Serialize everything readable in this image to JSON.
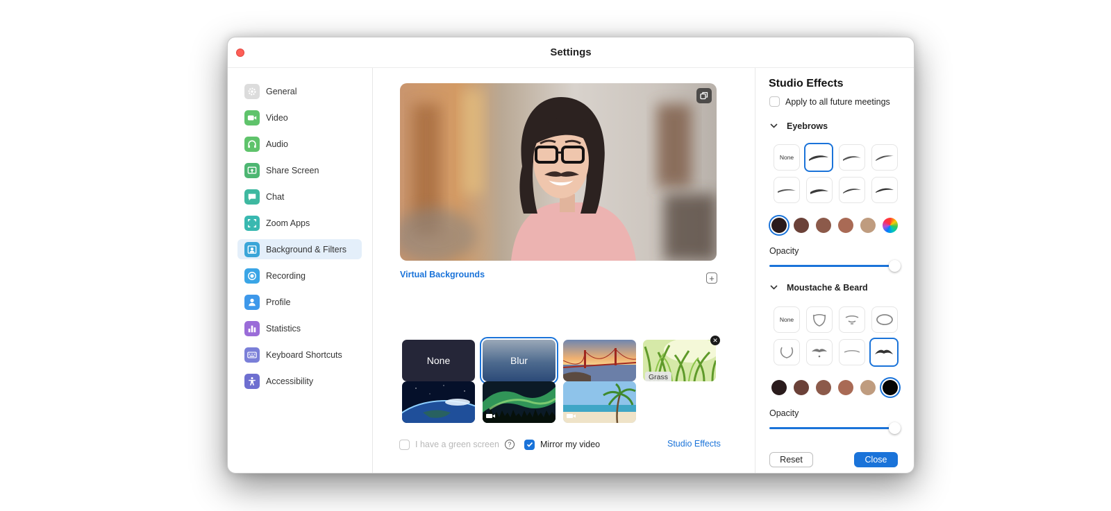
{
  "window": {
    "title": "Settings"
  },
  "sidebar": {
    "items": [
      {
        "label": "General",
        "icon": "gear-icon",
        "color": "#d9d9d9"
      },
      {
        "label": "Video",
        "icon": "video-camera-icon",
        "color": "#5fc36b"
      },
      {
        "label": "Audio",
        "icon": "headphones-icon",
        "color": "#5fc36b"
      },
      {
        "label": "Share Screen",
        "icon": "share-screen-icon",
        "color": "#4db672"
      },
      {
        "label": "Chat",
        "icon": "chat-bubble-icon",
        "color": "#3eb8a0"
      },
      {
        "label": "Zoom Apps",
        "icon": "zoom-apps-icon",
        "color": "#39b8b0"
      },
      {
        "label": "Background & Filters",
        "icon": "portrait-icon",
        "color": "#3aa5d8"
      },
      {
        "label": "Recording",
        "icon": "record-icon",
        "color": "#3aa5e6"
      },
      {
        "label": "Profile",
        "icon": "person-icon",
        "color": "#3e98ea"
      },
      {
        "label": "Statistics",
        "icon": "bar-chart-icon",
        "color": "#9a6cd8"
      },
      {
        "label": "Keyboard Shortcuts",
        "icon": "keyboard-icon",
        "color": "#7a7fd8"
      },
      {
        "label": "Accessibility",
        "icon": "accessibility-icon",
        "color": "#6e6fd0"
      }
    ],
    "active_index": 6
  },
  "center": {
    "virtual_backgrounds_label": "Virtual Backgrounds",
    "backgrounds": [
      {
        "label": "None",
        "kind": "none"
      },
      {
        "label": "Blur",
        "kind": "blur",
        "selected": true
      },
      {
        "label": "",
        "kind": "golden-gate-bridge"
      },
      {
        "label": "Grass",
        "kind": "grass"
      },
      {
        "label": "",
        "kind": "earth-from-space"
      },
      {
        "label": "",
        "kind": "aurora",
        "video": true
      },
      {
        "label": "",
        "kind": "beach",
        "video": true
      }
    ],
    "green_screen_label": "I have a green screen",
    "green_screen_checked": false,
    "mirror_label": "Mirror my video",
    "mirror_checked": true,
    "studio_effects_link": "Studio Effects"
  },
  "studio": {
    "title": "Studio Effects",
    "apply_label": "Apply to all future meetings",
    "apply_checked": false,
    "eyebrows_label": "Eyebrows",
    "moustache_label": "Moustache & Beard",
    "none_label": "None",
    "opacity_label": "Opacity",
    "eyebrow_colors": [
      "#2a1b1c",
      "#6b4138",
      "#8c5a4a",
      "#a96a55",
      "#bf9c7f"
    ],
    "beard_colors": [
      "#2a1b1c",
      "#6b4138",
      "#8c5a4a",
      "#a96a55",
      "#bf9c7f",
      "#050505"
    ],
    "eyebrow_opacity": 1.0,
    "beard_opacity": 1.0,
    "reset_label": "Reset",
    "close_label": "Close"
  }
}
